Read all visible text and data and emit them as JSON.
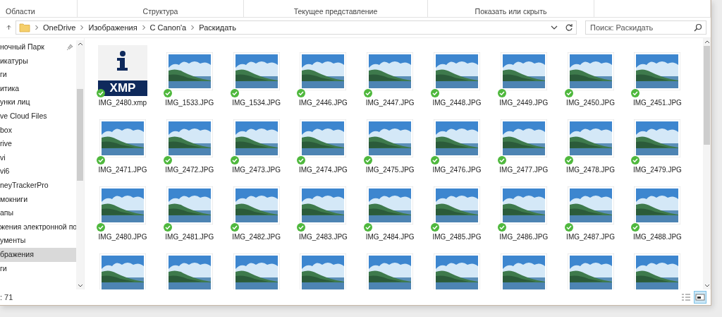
{
  "ribbon": {
    "groups": [
      "Области",
      "Структура",
      "Текущее представление",
      "Показать или скрыть"
    ]
  },
  "address": {
    "path": [
      "OneDrive",
      "Изображения",
      "C Canon'a",
      "Раскидать"
    ]
  },
  "search": {
    "placeholder": "Поиск: Раскидать"
  },
  "sidebar": {
    "items": [
      {
        "label": "ночный Парк",
        "pinned": true,
        "selected": false
      },
      {
        "label": "икатуры",
        "pinned": false,
        "selected": false
      },
      {
        "label": "ги",
        "pinned": false,
        "selected": false
      },
      {
        "label": "итика",
        "pinned": false,
        "selected": false
      },
      {
        "label": "унки лиц",
        "pinned": false,
        "selected": false
      },
      {
        "label": "ve Cloud Files",
        "pinned": false,
        "selected": false
      },
      {
        "label": "box",
        "pinned": false,
        "selected": false
      },
      {
        "label": "rive",
        "pinned": false,
        "selected": false
      },
      {
        "label": "vi",
        "pinned": false,
        "selected": false
      },
      {
        "label": "vi6",
        "pinned": false,
        "selected": false
      },
      {
        "label": "neyTrackerPro",
        "pinned": false,
        "selected": false
      },
      {
        "label": "мокниги",
        "pinned": false,
        "selected": false
      },
      {
        "label": "апы",
        "pinned": false,
        "selected": false
      },
      {
        "label": "жения электронной по",
        "pinned": false,
        "selected": false
      },
      {
        "label": "ументы",
        "pinned": false,
        "selected": false
      },
      {
        "label": "бражения",
        "pinned": false,
        "selected": true
      },
      {
        "label": "ги",
        "pinned": false,
        "selected": false
      }
    ]
  },
  "files": [
    {
      "kind": "xmp",
      "badge": "XMP",
      "name": "IMG_2480.xmp",
      "synced": true
    },
    {
      "kind": "image",
      "name": "IMG_1533.JPG",
      "synced": true
    },
    {
      "kind": "image",
      "name": "IMG_1534.JPG",
      "synced": true
    },
    {
      "kind": "image",
      "name": "IMG_2446.JPG",
      "synced": true
    },
    {
      "kind": "image",
      "name": "IMG_2447.JPG",
      "synced": true
    },
    {
      "kind": "image",
      "name": "IMG_2448.JPG",
      "synced": true
    },
    {
      "kind": "image",
      "name": "IMG_2449.JPG",
      "synced": true
    },
    {
      "kind": "image",
      "name": "IMG_2450.JPG",
      "synced": true
    },
    {
      "kind": "image",
      "name": "IMG_2451.JPG",
      "synced": true
    },
    {
      "kind": "image",
      "name": "IMG_2471.JPG",
      "synced": true
    },
    {
      "kind": "image",
      "name": "IMG_2472.JPG",
      "synced": true
    },
    {
      "kind": "image",
      "name": "IMG_2473.JPG",
      "synced": true
    },
    {
      "kind": "image",
      "name": "IMG_2474.JPG",
      "synced": true
    },
    {
      "kind": "image",
      "name": "IMG_2475.JPG",
      "synced": true
    },
    {
      "kind": "image",
      "name": "IMG_2476.JPG",
      "synced": true
    },
    {
      "kind": "image",
      "name": "IMG_2477.JPG",
      "synced": true
    },
    {
      "kind": "image",
      "name": "IMG_2478.JPG",
      "synced": true
    },
    {
      "kind": "image",
      "name": "IMG_2479.JPG",
      "synced": true
    },
    {
      "kind": "image",
      "name": "IMG_2480.JPG",
      "synced": true
    },
    {
      "kind": "image",
      "name": "IMG_2481.JPG",
      "synced": true
    },
    {
      "kind": "image",
      "name": "IMG_2482.JPG",
      "synced": true
    },
    {
      "kind": "image",
      "name": "IMG_2483.JPG",
      "synced": true
    },
    {
      "kind": "image",
      "name": "IMG_2484.JPG",
      "synced": true
    },
    {
      "kind": "image",
      "name": "IMG_2485.JPG",
      "synced": true
    },
    {
      "kind": "image",
      "name": "IMG_2486.JPG",
      "synced": true
    },
    {
      "kind": "image",
      "name": "IMG_2487.JPG",
      "synced": true
    },
    {
      "kind": "image",
      "name": "IMG_2488.JPG",
      "synced": true
    },
    {
      "kind": "image"
    },
    {
      "kind": "image"
    },
    {
      "kind": "image"
    },
    {
      "kind": "image"
    },
    {
      "kind": "image"
    },
    {
      "kind": "image"
    },
    {
      "kind": "image"
    },
    {
      "kind": "image"
    },
    {
      "kind": "image"
    }
  ],
  "status_bar": {
    "count": ": 71"
  },
  "view_buttons": [
    {
      "kind": "details",
      "selected": false
    },
    {
      "kind": "icons",
      "selected": true
    }
  ]
}
